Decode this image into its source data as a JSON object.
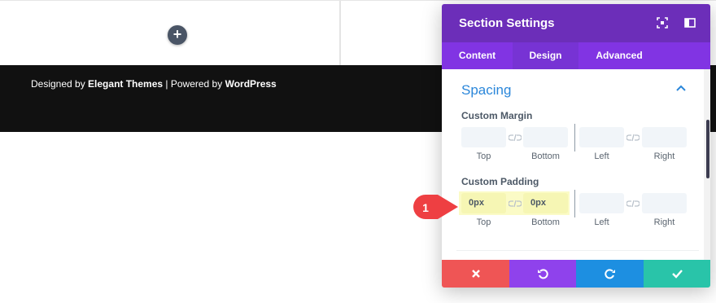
{
  "page": {
    "add_icon": "plus-icon",
    "footer": {
      "prefix": "Designed by ",
      "theme_name": "Elegant Themes",
      "separator": " | Powered by ",
      "platform": "WordPress"
    }
  },
  "modal": {
    "title": "Section Settings",
    "header_icons": [
      "focus-mode-icon",
      "split-view-icon"
    ],
    "tabs": [
      {
        "label": "Content",
        "active": false
      },
      {
        "label": "Design",
        "active": true
      },
      {
        "label": "Advanced",
        "active": false
      }
    ],
    "group": {
      "title": "Spacing",
      "expanded": true
    },
    "custom_margin": {
      "label": "Custom Margin",
      "top": {
        "value": "",
        "label": "Top"
      },
      "bottom": {
        "value": "",
        "label": "Bottom"
      },
      "left": {
        "value": "",
        "label": "Left"
      },
      "right": {
        "value": "",
        "label": "Right"
      }
    },
    "custom_padding": {
      "label": "Custom Padding",
      "top": {
        "value": "0px",
        "label": "Top"
      },
      "bottom": {
        "value": "0px",
        "label": "Bottom"
      },
      "left": {
        "value": "",
        "label": "Left"
      },
      "right": {
        "value": "",
        "label": "Right"
      }
    },
    "footer_buttons": [
      "discard-icon",
      "undo-icon",
      "redo-icon",
      "save-check-icon"
    ]
  },
  "step_marker": {
    "number": "1"
  },
  "colors": {
    "header": "#6c2eb9",
    "tabs": "#8134e3",
    "group_title": "#2b87da",
    "highlight": "#f6f6b4",
    "discard": "#ef5555",
    "undo": "#8f42ec",
    "redo": "#1d8fe1",
    "save": "#29c4a9",
    "marker": "#ee3f42"
  }
}
